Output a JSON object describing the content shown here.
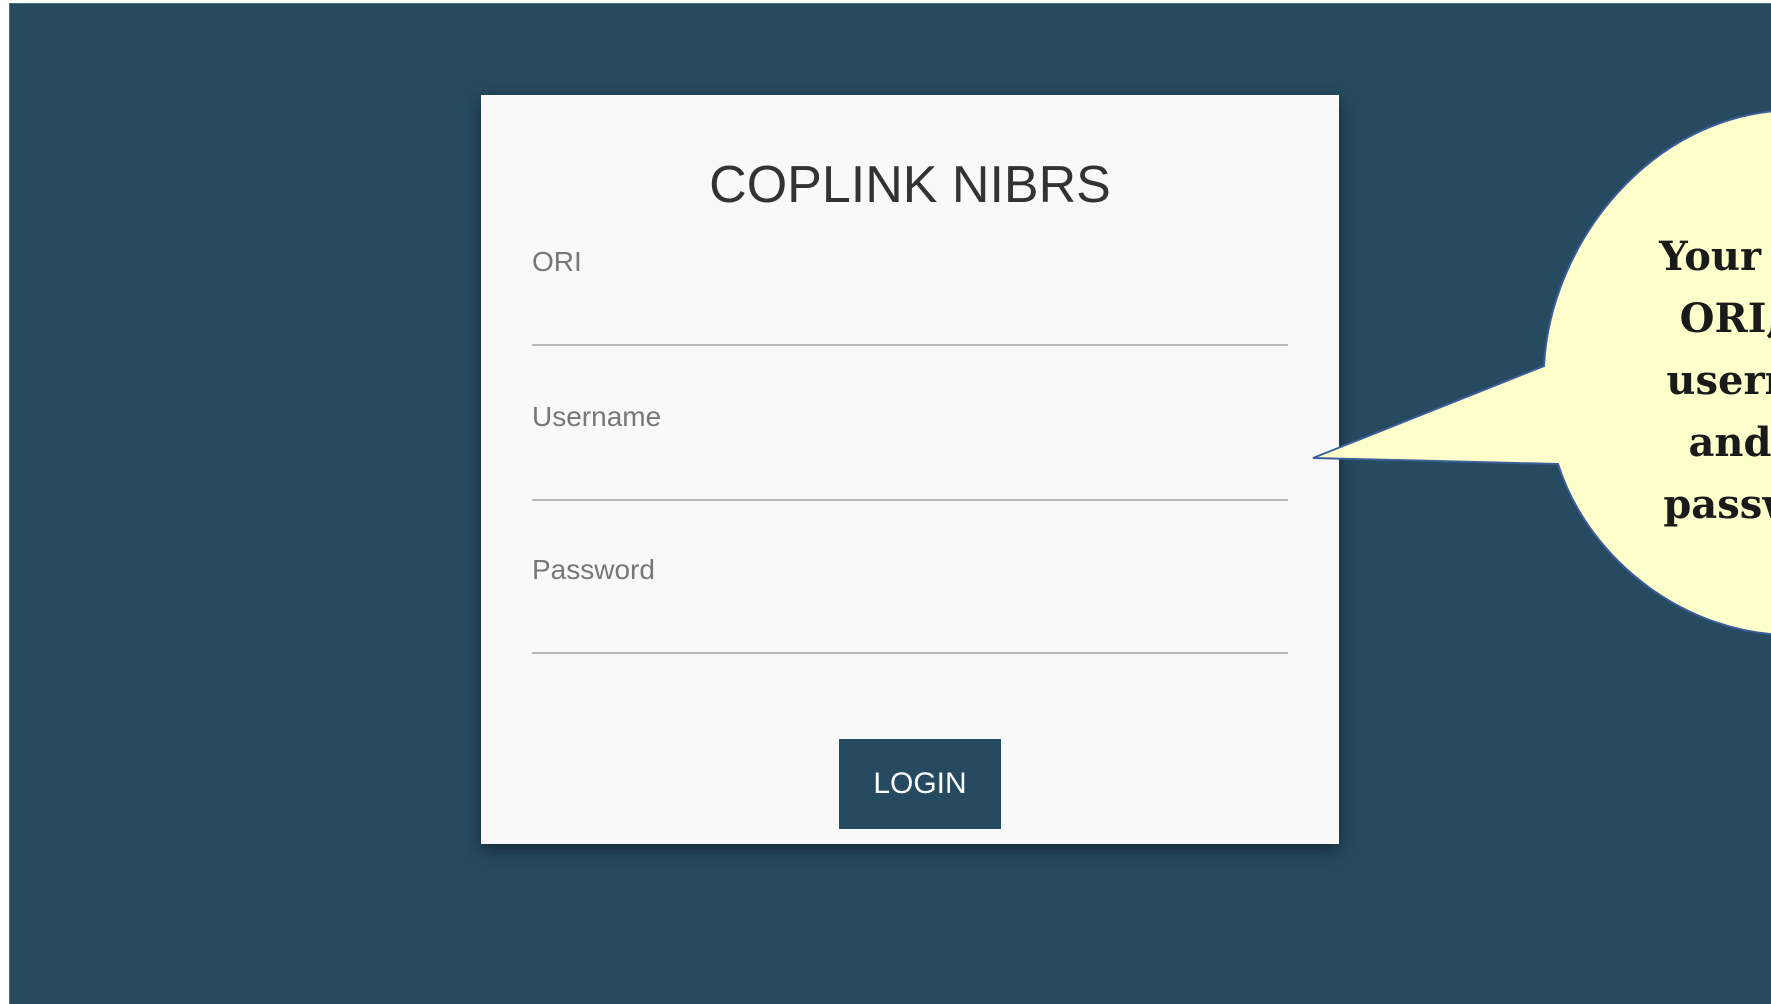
{
  "login": {
    "title": "COPLINK NIBRS",
    "ori_label": "ORI",
    "ori_value": "",
    "username_label": "Username",
    "username_value": "",
    "password_label": "Password",
    "password_value": "",
    "login_button": "LOGIN"
  },
  "callout": {
    "text": "Your a\nORI,\nusern\nand\npassw"
  },
  "colors": {
    "background": "#264a60",
    "card": "#f9f9f9",
    "button": "#264a60",
    "callout_fill": "#ffffcc",
    "callout_border": "#3c5f9a"
  }
}
